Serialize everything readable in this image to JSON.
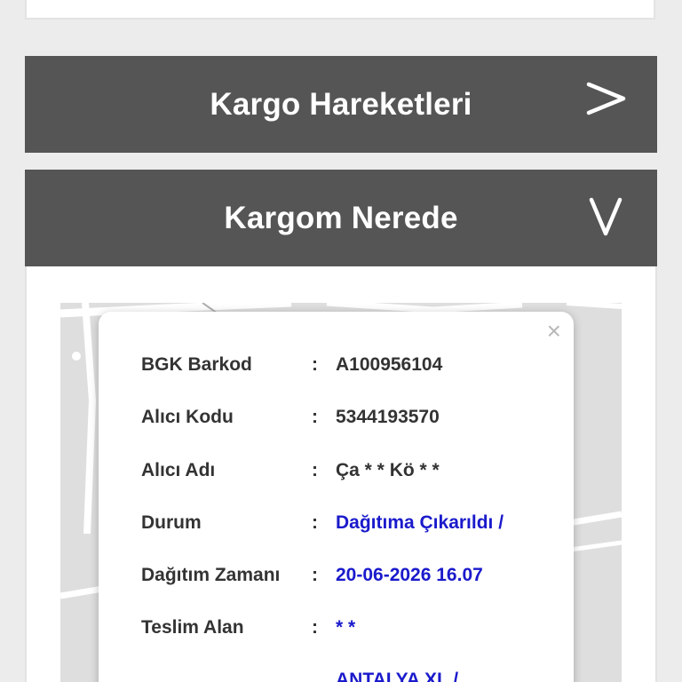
{
  "sections": [
    {
      "title": "Kargo Hareketleri",
      "state": "collapsed",
      "chevron": "chevron-right-icon"
    },
    {
      "title": "Kargom Nerede",
      "state": "expanded",
      "chevron": "chevron-down-icon"
    }
  ],
  "popup": {
    "close_symbol": "×",
    "separator": ":",
    "rows": [
      {
        "label": "BGK Barkod",
        "value": "A100956104"
      },
      {
        "label": "Alıcı Kodu",
        "value": "5344193570"
      },
      {
        "label": "Alıcı Adı",
        "value": "Ça * * Kö * *"
      },
      {
        "label": "Durum",
        "value": "Dağıtıma Çıkarıldı /"
      },
      {
        "label": "Dağıtım Zamanı",
        "value": "20-06-2026 16.07"
      },
      {
        "label": "Teslim Alan",
        "value": "* *"
      },
      {
        "label": "",
        "value": "ANTALYA XL /"
      }
    ]
  },
  "colors": {
    "header_bg": "#555555",
    "link_blue": "#1a1acc",
    "label_text": "#333333"
  }
}
